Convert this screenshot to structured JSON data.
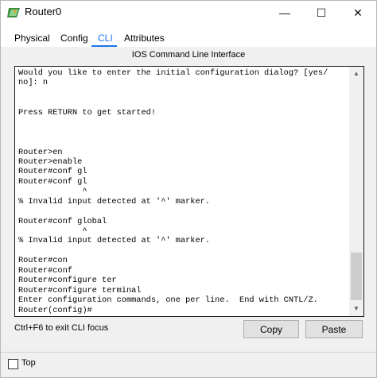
{
  "window": {
    "title": "Router0",
    "minimize_glyph": "—",
    "maximize_glyph": "☐",
    "close_glyph": "✕"
  },
  "tabs": [
    {
      "label": "Physical",
      "active": false
    },
    {
      "label": "Config",
      "active": false
    },
    {
      "label": "CLI",
      "active": true
    },
    {
      "label": "Attributes",
      "active": false
    }
  ],
  "panel": {
    "title": "IOS Command Line Interface"
  },
  "terminal": {
    "lines": [
      "Would you like to enter the initial configuration dialog? [yes/",
      "no]: n",
      "",
      "",
      "Press RETURN to get started!",
      "",
      "",
      "",
      "Router>en",
      "Router>enable",
      "Router#conf gl",
      "Router#conf gl",
      "             ^",
      "% Invalid input detected at '^' marker.",
      "",
      "Router#conf global",
      "             ^",
      "% Invalid input detected at '^' marker.",
      "",
      "Router#con",
      "Router#conf",
      "Router#configure ter",
      "Router#configure terminal",
      "Enter configuration commands, one per line.  End with CNTL/Z.",
      "Router(config)#"
    ]
  },
  "footer": {
    "hint": "Ctrl+F6 to exit CLI focus",
    "copy_label": "Copy",
    "paste_label": "Paste",
    "top_label": "Top"
  },
  "colors": {
    "accent": "#1a73e8",
    "terminal_bg": "#ffffff",
    "window_bg": "#f0f0f0"
  },
  "icons": {
    "app": "router-app-icon",
    "scroll_up": "scroll-up-arrow-icon",
    "scroll_down": "scroll-down-arrow-icon"
  }
}
